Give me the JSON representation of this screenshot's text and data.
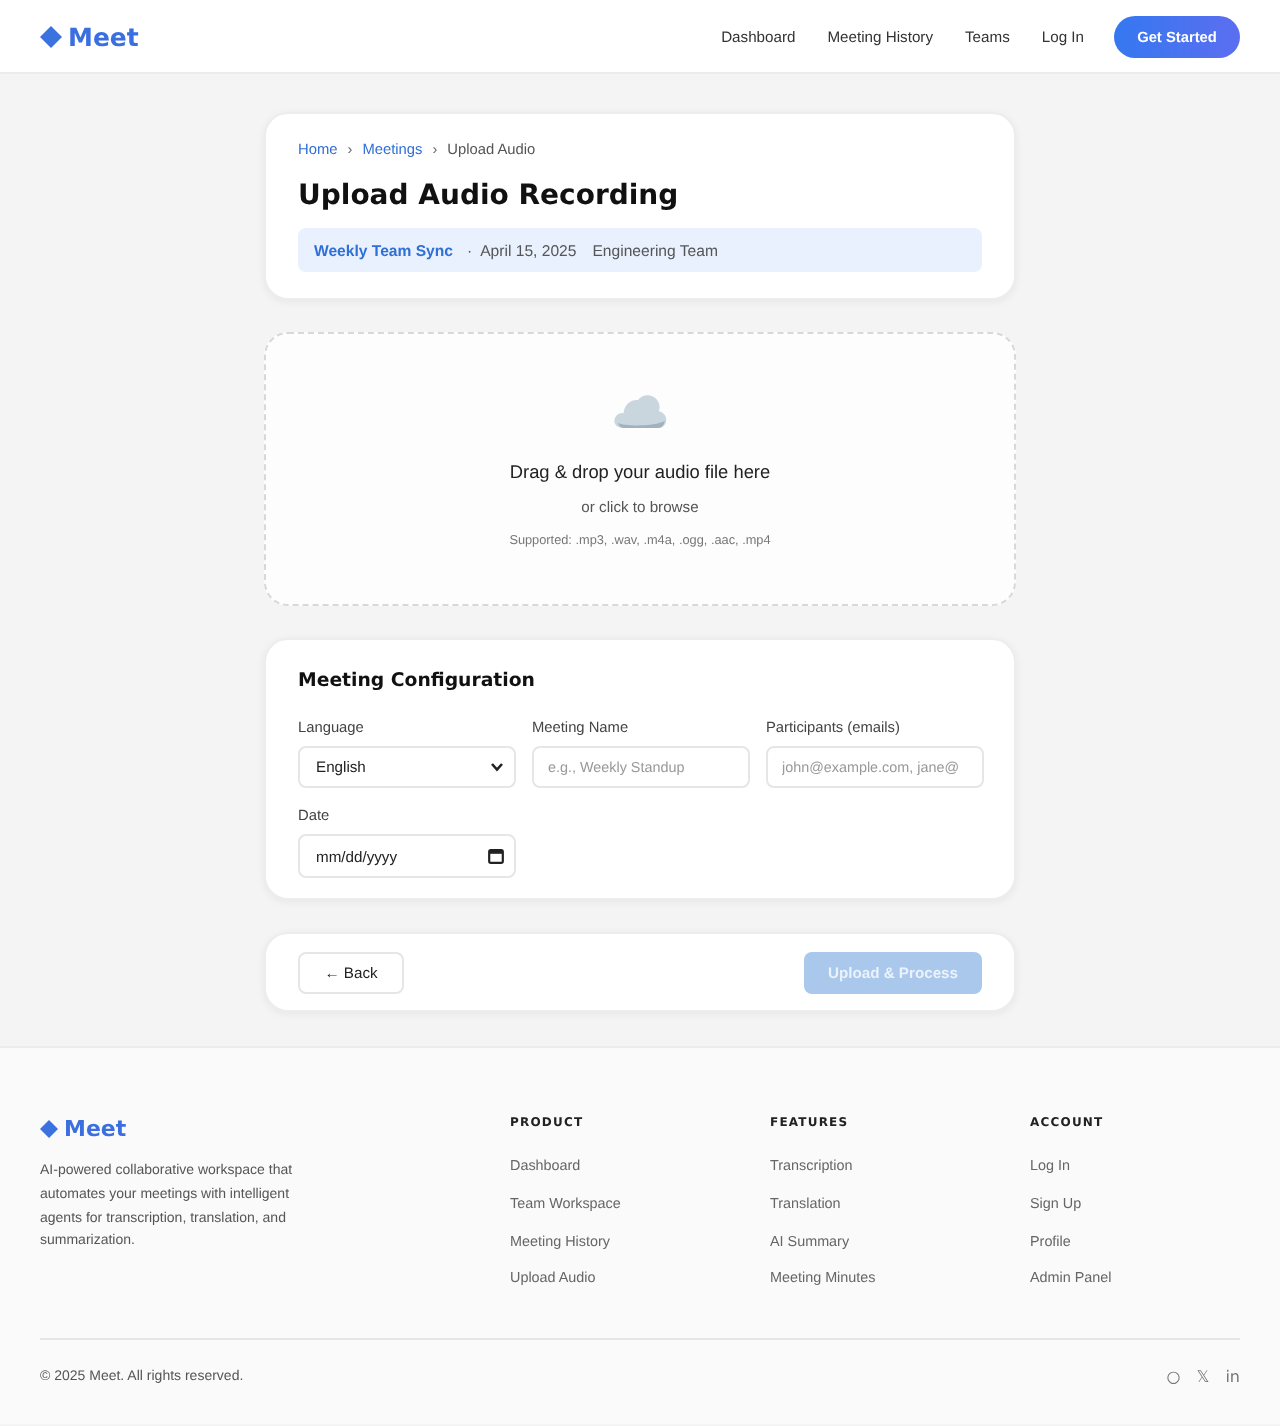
{
  "header": {
    "logo": "Meet",
    "nav": [
      {
        "label": "Dashboard"
      },
      {
        "label": "Meeting History"
      },
      {
        "label": "Teams"
      },
      {
        "label": "Log In"
      }
    ],
    "cta": "Get Started"
  },
  "page_header": {
    "breadcrumb": [
      {
        "kind": "link",
        "label": "Home"
      },
      {
        "kind": "separator",
        "label": "›"
      },
      {
        "kind": "link",
        "label": "Meetings"
      },
      {
        "kind": "separator",
        "label": "›"
      },
      {
        "kind": "current",
        "label": "Upload Audio"
      }
    ],
    "title": "Upload Audio Recording",
    "meeting": {
      "name": "Weekly Team Sync",
      "separator": "·",
      "date": "April 15, 2025",
      "team": "Engineering Team"
    }
  },
  "dropzone": {
    "title": "Drag & drop your audio file here",
    "subtitle": "or click to browse",
    "formats": "Supported: .mp3, .wav, .m4a, .ogg, .aac, .mp4"
  },
  "configuration": {
    "title": "Meeting Configuration",
    "fields": [
      {
        "kind": "select",
        "label": "Language",
        "value": "English"
      },
      {
        "kind": "text",
        "label": "Meeting Name",
        "placeholder": "e.g., Weekly Standup"
      },
      {
        "kind": "text",
        "label": "Participants (emails)",
        "placeholder": "john@example.com, jane@"
      },
      {
        "kind": "date",
        "label": "Date",
        "placeholder": "mm/dd/yyyy"
      }
    ]
  },
  "actions": {
    "back": {
      "label": "← Back",
      "disabled": false
    },
    "submit": {
      "label": "Upload & Process",
      "disabled": true
    }
  },
  "footer": {
    "logo": "Meet",
    "description": "AI-powered collaborative workspace that automates your meetings with intelligent agents for transcription, translation, and summarization.",
    "columns": [
      {
        "heading": "PRODUCT",
        "links": [
          "Dashboard",
          "Team Workspace",
          "Meeting History",
          "Upload Audio"
        ]
      },
      {
        "heading": "FEATURES",
        "links": [
          "Transcription",
          "Translation",
          "AI Summary",
          "Meeting Minutes"
        ]
      },
      {
        "heading": "ACCOUNT",
        "links": [
          "Log In",
          "Sign Up",
          "Profile",
          "Admin Panel"
        ]
      }
    ],
    "copyright": "© 2025 Meet. All rights reserved.",
    "social": [
      "○",
      "𝕏",
      "in"
    ]
  }
}
